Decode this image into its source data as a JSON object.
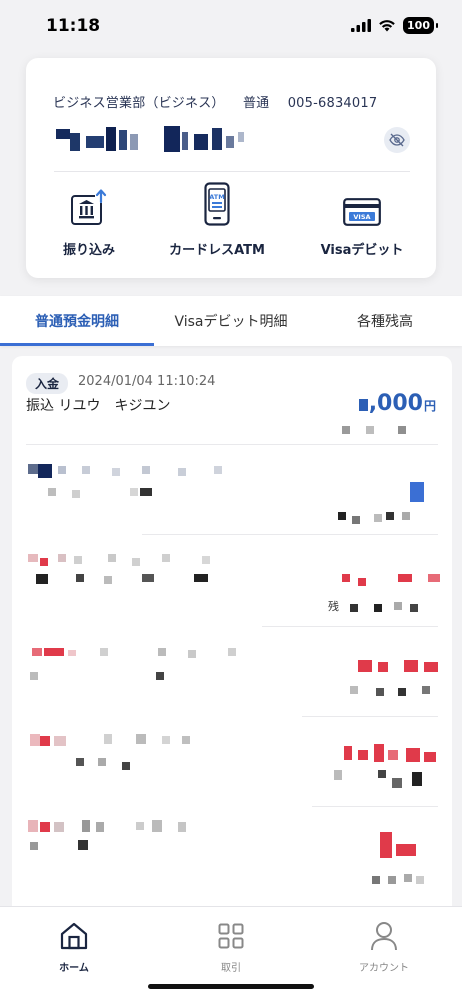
{
  "status_bar": {
    "time": "11:18",
    "battery": "100"
  },
  "account": {
    "branch": "ビジネス営業部（ビジネス）",
    "type": "普通",
    "number": "005-6834017",
    "eye_icon": "eye-slash-icon"
  },
  "actions": [
    {
      "label": "振り込み",
      "icon": "bank-transfer-icon"
    },
    {
      "label": "カードレスATM",
      "icon": "atm-phone-icon"
    },
    {
      "label": "Visaデビット",
      "icon": "visa-card-icon"
    }
  ],
  "tabs": [
    {
      "label": "普通預金明細",
      "active": true
    },
    {
      "label": "Visaデビット明細",
      "active": false
    },
    {
      "label": "各種残高",
      "active": false
    }
  ],
  "transactions": {
    "first": {
      "badge": "入金",
      "datetime": "2024/01/04 11:10:24",
      "description": "振込 リユウ　キジユン",
      "amount_visible": ",000",
      "currency": "円"
    },
    "zan_label": "残"
  },
  "bottom_nav": [
    {
      "label": "ホーム",
      "icon": "home-icon",
      "active": true
    },
    {
      "label": "取引",
      "icon": "grid-icon",
      "active": false
    },
    {
      "label": "アカウント",
      "icon": "user-icon",
      "active": false
    }
  ],
  "colors": {
    "accent": "#2c5fb5",
    "expense": "#e03a4a",
    "navy": "#1a2540"
  }
}
